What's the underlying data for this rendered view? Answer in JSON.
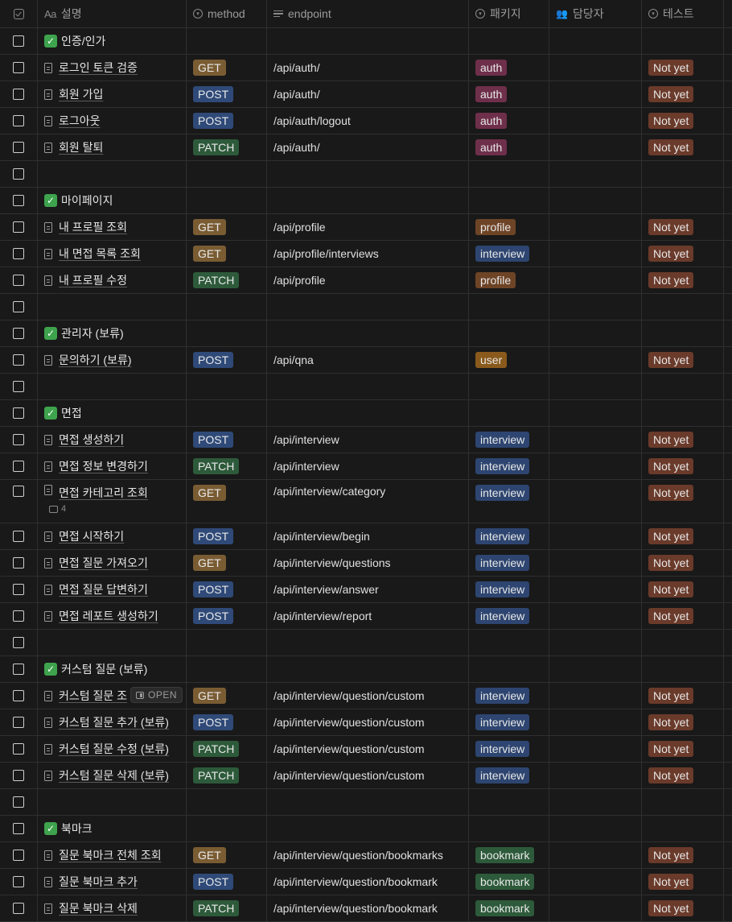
{
  "header": {
    "title": "설명",
    "method": "method",
    "endpoint": "endpoint",
    "package": "패키지",
    "owner": "담당자",
    "test": "테스트"
  },
  "open_label": "OPEN",
  "rows": [
    {
      "type": "section",
      "title": "인증/인가"
    },
    {
      "type": "item",
      "title": "로그인 토큰 검증",
      "method": "GET",
      "endpoint": "/api/auth/",
      "package": "auth",
      "test": "Not yet"
    },
    {
      "type": "item",
      "title": "회원 가입",
      "method": "POST",
      "endpoint": "/api/auth/",
      "package": "auth",
      "test": "Not yet"
    },
    {
      "type": "item",
      "title": "로그아웃",
      "method": "POST",
      "endpoint": "/api/auth/logout",
      "package": "auth",
      "test": "Not yet"
    },
    {
      "type": "item",
      "title": "회원 탈퇴",
      "method": "PATCH",
      "endpoint": "/api/auth/",
      "package": "auth",
      "test": "Not yet"
    },
    {
      "type": "empty"
    },
    {
      "type": "section",
      "title": "마이페이지"
    },
    {
      "type": "item",
      "title": "내 프로필 조회",
      "method": "GET",
      "endpoint": "/api/profile",
      "package": "profile",
      "test": "Not yet"
    },
    {
      "type": "item",
      "title": "내 면접 목록 조회",
      "method": "GET",
      "endpoint": "/api/profile/interviews",
      "package": "interview",
      "test": "Not yet"
    },
    {
      "type": "item",
      "title": "내 프로필 수정",
      "method": "PATCH",
      "endpoint": "/api/profile",
      "package": "profile",
      "test": "Not yet"
    },
    {
      "type": "empty"
    },
    {
      "type": "section",
      "title": "관리자 (보류)"
    },
    {
      "type": "item",
      "title": "문의하기 (보류)",
      "method": "POST",
      "endpoint": "/api/qna",
      "package": "user",
      "test": "Not yet"
    },
    {
      "type": "empty"
    },
    {
      "type": "section",
      "title": "면접"
    },
    {
      "type": "item",
      "title": "면접 생성하기",
      "method": "POST",
      "endpoint": "/api/interview",
      "package": "interview",
      "test": "Not yet"
    },
    {
      "type": "item",
      "title": "면접 정보 변경하기",
      "method": "PATCH",
      "endpoint": "/api/interview",
      "package": "interview",
      "test": "Not yet"
    },
    {
      "type": "item",
      "title": "면접 카테고리 조회",
      "method": "GET",
      "endpoint": "/api/interview/category",
      "package": "interview",
      "test": "Not yet",
      "comments": "4"
    },
    {
      "type": "item",
      "title": "면접 시작하기",
      "method": "POST",
      "endpoint": "/api/interview/begin",
      "package": "interview",
      "test": "Not yet"
    },
    {
      "type": "item",
      "title": "면접 질문 가져오기",
      "method": "GET",
      "endpoint": "/api/interview/questions",
      "package": "interview",
      "test": "Not yet"
    },
    {
      "type": "item",
      "title": "면접 질문 답변하기",
      "method": "POST",
      "endpoint": "/api/interview/answer",
      "package": "interview",
      "test": "Not yet"
    },
    {
      "type": "item",
      "title": "면접 레포트 생성하기",
      "method": "POST",
      "endpoint": "/api/interview/report",
      "package": "interview",
      "test": "Not yet"
    },
    {
      "type": "empty"
    },
    {
      "type": "section",
      "title": "커스텀 질문 (보류)"
    },
    {
      "type": "item",
      "title": "커스텀 질문 조",
      "method": "GET",
      "endpoint": "/api/interview/question/custom",
      "package": "interview",
      "test": "Not yet",
      "open": true
    },
    {
      "type": "item",
      "title": "커스텀 질문 추가 (보류)",
      "method": "POST",
      "endpoint": "/api/interview/question/custom",
      "package": "interview",
      "test": "Not yet"
    },
    {
      "type": "item",
      "title": "커스텀 질문 수정 (보류)",
      "method": "PATCH",
      "endpoint": "/api/interview/question/custom",
      "package": "interview",
      "test": "Not yet"
    },
    {
      "type": "item",
      "title": "커스텀 질문 삭제 (보류)",
      "method": "PATCH",
      "endpoint": "/api/interview/question/custom",
      "package": "interview",
      "test": "Not yet"
    },
    {
      "type": "empty"
    },
    {
      "type": "section",
      "title": "북마크"
    },
    {
      "type": "item",
      "title": "질문 북마크 전체 조회",
      "method": "GET",
      "endpoint": "/api/interview/question/bookmarks",
      "package": "bookmark",
      "test": "Not yet"
    },
    {
      "type": "item",
      "title": "질문 북마크 추가",
      "method": "POST",
      "endpoint": "/api/interview/question/bookmark",
      "package": "bookmark",
      "test": "Not yet"
    },
    {
      "type": "item",
      "title": "질문 북마크 삭제",
      "method": "PATCH",
      "endpoint": "/api/interview/question/bookmark",
      "package": "bookmark",
      "test": "Not yet"
    }
  ]
}
